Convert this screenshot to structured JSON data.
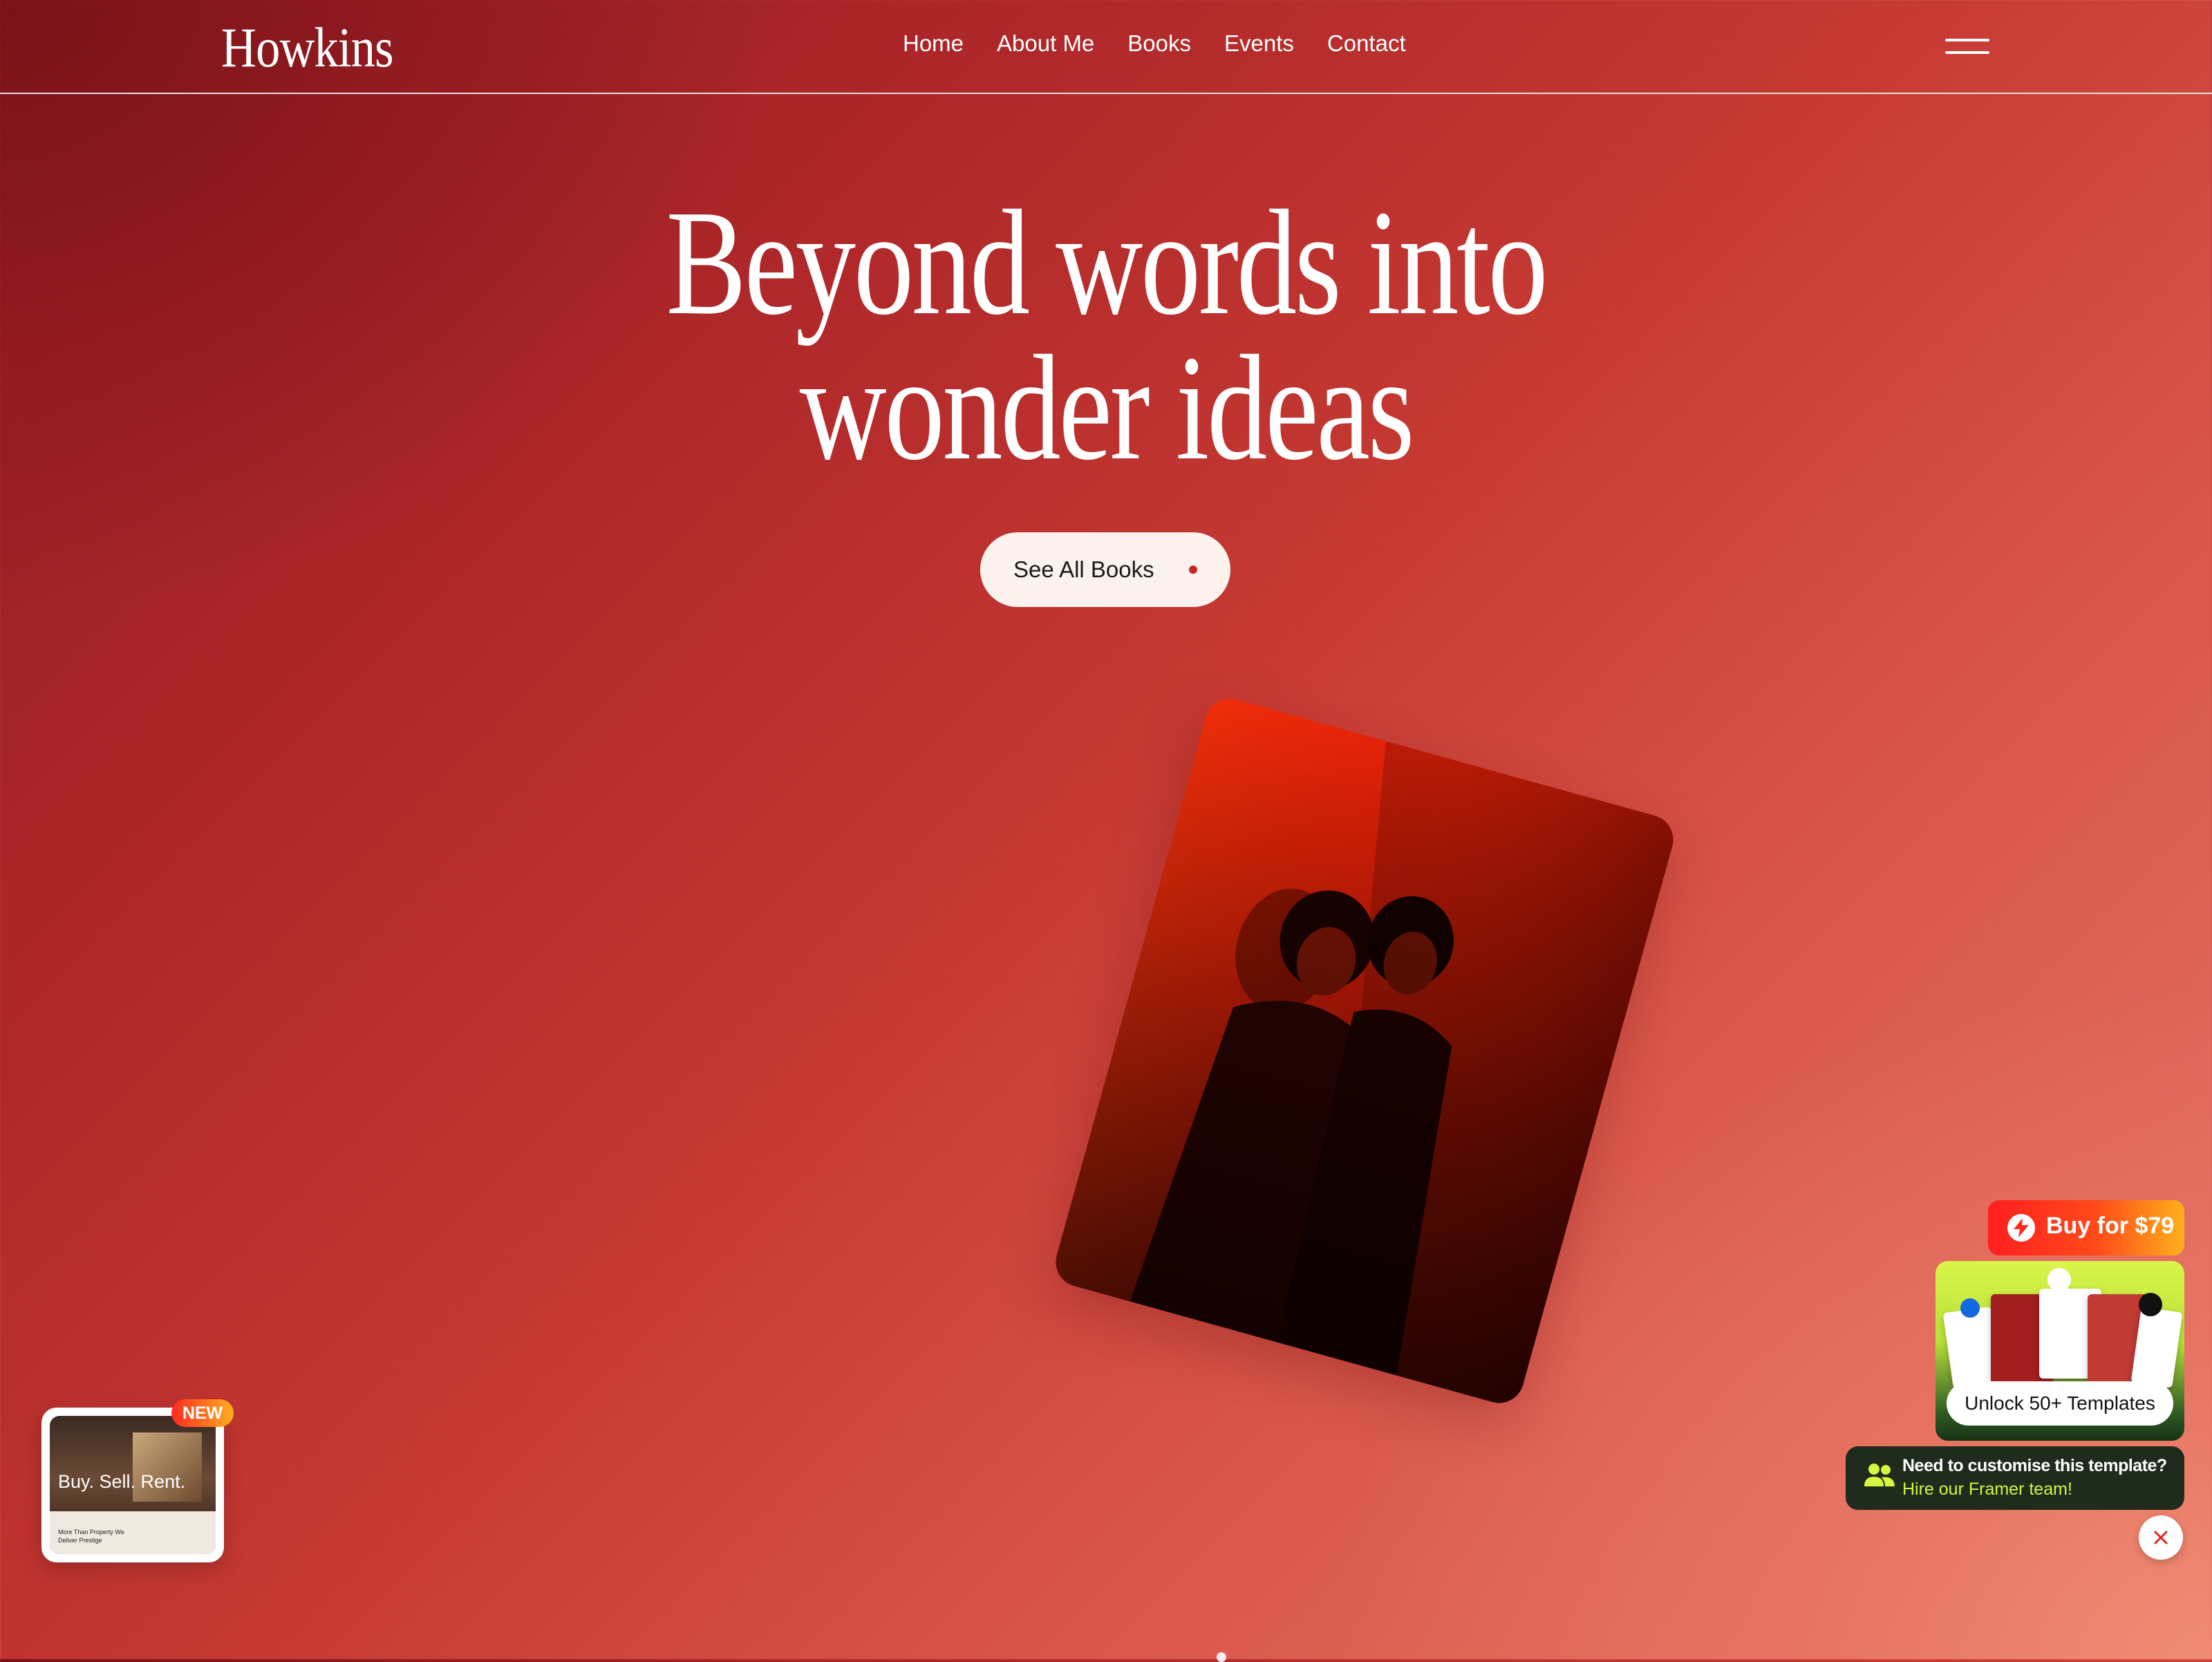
{
  "nav": {
    "logo": "Howkins",
    "links": [
      "Home",
      "About Me",
      "Books",
      "Events",
      "Contact"
    ],
    "menu_icon": "hamburger-icon"
  },
  "hero": {
    "title_line1": "Beyond words into",
    "title_line2": "wonder ideas",
    "cta_label": "See All Books",
    "cta_dot_color": "#c52a1e"
  },
  "promo": {
    "badge": "NEW",
    "headline": "Buy. Sell. Rent.",
    "sub": "More Than Property We Deliver Prestige"
  },
  "widgets": {
    "buy_label": "Buy for $79",
    "unlock_label": "Unlock 50+ Templates",
    "hire_line1": "Need to customise this template?",
    "hire_line2": "Hire our Framer team!"
  },
  "colors": {
    "accent_red": "#ff1f1f",
    "accent_lime": "#d7f53f",
    "dark_green": "#1f2b1d",
    "cta_bg": "#fbf2ee"
  }
}
